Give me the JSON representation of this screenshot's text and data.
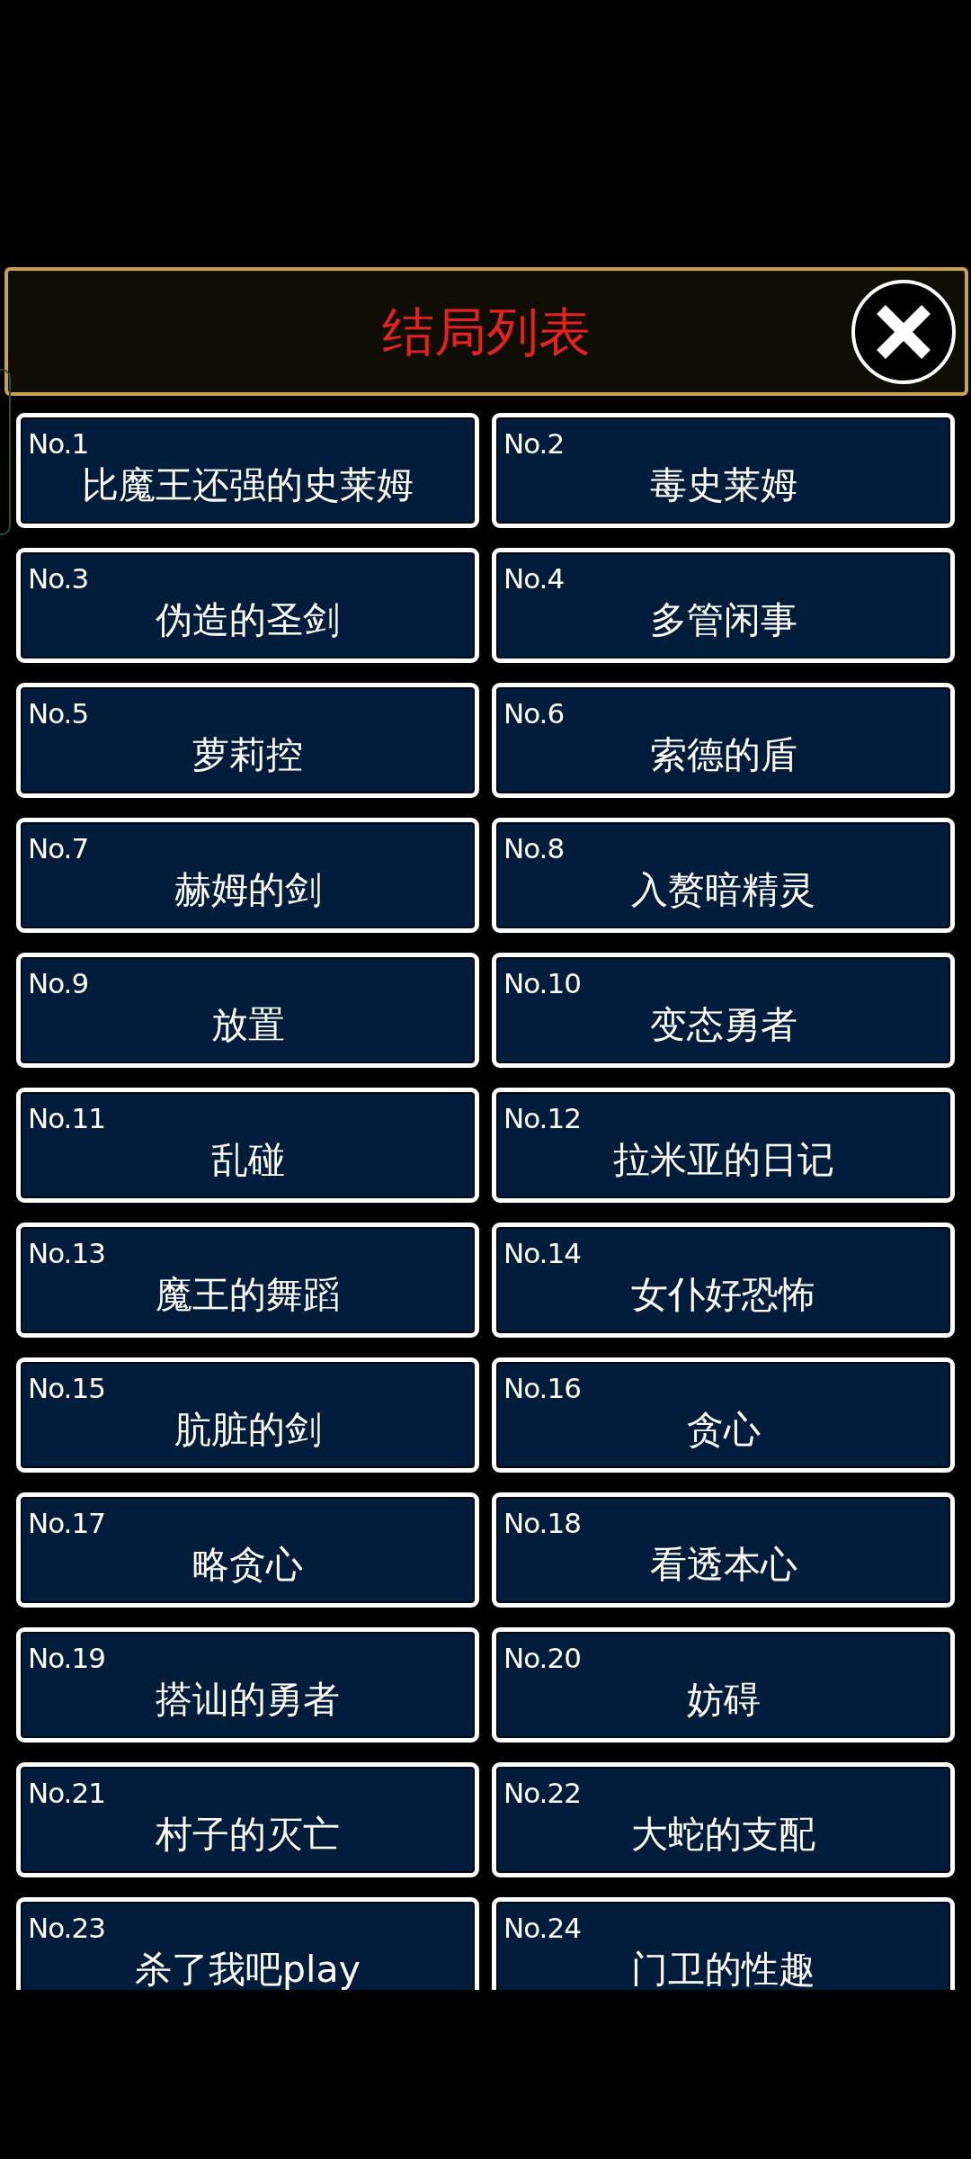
{
  "header": {
    "title": "结局列表"
  },
  "endings": [
    {
      "number": "No.1",
      "title": "比魔王还强的史莱姆"
    },
    {
      "number": "No.2",
      "title": "毒史莱姆"
    },
    {
      "number": "No.3",
      "title": "伪造的圣剑"
    },
    {
      "number": "No.4",
      "title": "多管闲事"
    },
    {
      "number": "No.5",
      "title": "萝莉控"
    },
    {
      "number": "No.6",
      "title": "索德的盾"
    },
    {
      "number": "No.7",
      "title": "赫姆的剑"
    },
    {
      "number": "No.8",
      "title": "入赘暗精灵"
    },
    {
      "number": "No.9",
      "title": "放置"
    },
    {
      "number": "No.10",
      "title": "变态勇者"
    },
    {
      "number": "No.11",
      "title": "乱碰"
    },
    {
      "number": "No.12",
      "title": "拉米亚的日记"
    },
    {
      "number": "No.13",
      "title": "魔王的舞蹈"
    },
    {
      "number": "No.14",
      "title": "女仆好恐怖"
    },
    {
      "number": "No.15",
      "title": "肮脏的剑"
    },
    {
      "number": "No.16",
      "title": "贪心"
    },
    {
      "number": "No.17",
      "title": "略贪心"
    },
    {
      "number": "No.18",
      "title": "看透本心"
    },
    {
      "number": "No.19",
      "title": "搭讪的勇者"
    },
    {
      "number": "No.20",
      "title": "妨碍"
    },
    {
      "number": "No.21",
      "title": "村子的灭亡"
    },
    {
      "number": "No.22",
      "title": "大蛇的支配"
    },
    {
      "number": "No.23",
      "title": "杀了我吧play"
    },
    {
      "number": "No.24",
      "title": "门卫的性趣"
    }
  ]
}
